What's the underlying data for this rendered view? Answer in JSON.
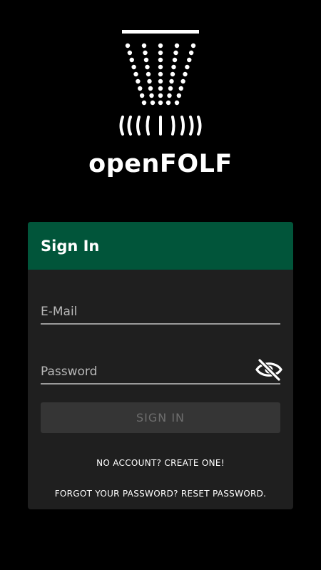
{
  "app": {
    "title": "openFOLF"
  },
  "signin_card": {
    "title": "Sign In",
    "email_placeholder": "E-Mail",
    "password_placeholder": "Password",
    "submit_label": "SIGN IN",
    "create_account_link": "NO ACCOUNT? CREATE ONE!",
    "reset_password_link": "FORGOT YOUR PASSWORD? RESET PASSWORD.",
    "password_toggle_icon": "eye-off-icon"
  },
  "colors": {
    "background": "#000000",
    "card": "#1f1f1f",
    "card_header": "#01553a",
    "button_disabled": "#353535",
    "underline": "#9a9a9a"
  }
}
